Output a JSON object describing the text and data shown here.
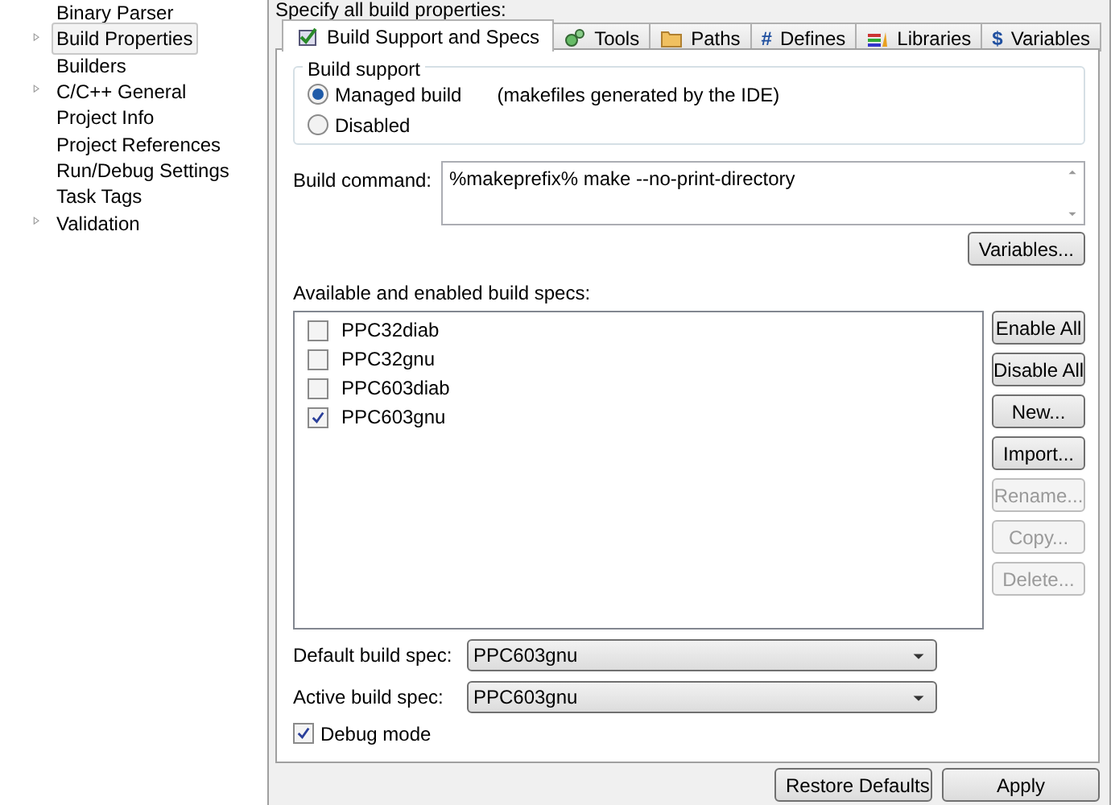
{
  "sidebar": {
    "items": [
      {
        "label": "Binary Parser",
        "expandable": false,
        "selected": false
      },
      {
        "label": "Build Properties",
        "expandable": true,
        "selected": true
      },
      {
        "label": "Builders",
        "expandable": false,
        "selected": false
      },
      {
        "label": "C/C++ General",
        "expandable": true,
        "selected": false
      },
      {
        "label": "Project Info",
        "expandable": false,
        "selected": false
      },
      {
        "label": "Project References",
        "expandable": false,
        "selected": false
      },
      {
        "label": "Run/Debug Settings",
        "expandable": false,
        "selected": false
      },
      {
        "label": "Task Tags",
        "expandable": false,
        "selected": false
      },
      {
        "label": "Validation",
        "expandable": true,
        "selected": false
      }
    ]
  },
  "header": "Specify all build properties:",
  "tabs": [
    {
      "label": "Build Support and Specs",
      "selected": true
    },
    {
      "label": "Tools",
      "selected": false
    },
    {
      "label": "Paths",
      "selected": false
    },
    {
      "glyph": "#",
      "label": "Defines",
      "selected": false
    },
    {
      "label": "Libraries",
      "selected": false
    },
    {
      "glyph": "$",
      "label": "Variables",
      "selected": false
    }
  ],
  "build_support": {
    "title": "Build support",
    "options": [
      {
        "label": "Managed build",
        "note": "(makefiles generated by the IDE)",
        "selected": true
      },
      {
        "label": "Disabled",
        "selected": false
      }
    ]
  },
  "build_command": {
    "label": "Build command:",
    "value": "%makeprefix% make --no-print-directory",
    "button": "Variables..."
  },
  "specs": {
    "label": "Available and enabled build specs:",
    "items": [
      {
        "label": "PPC32diab",
        "checked": false
      },
      {
        "label": "PPC32gnu",
        "checked": false
      },
      {
        "label": "PPC603diab",
        "checked": false
      },
      {
        "label": "PPC603gnu",
        "checked": true
      }
    ],
    "buttons": [
      {
        "label": "Enable All",
        "disabled": false
      },
      {
        "label": "Disable All",
        "disabled": false
      },
      {
        "label": "New...",
        "disabled": false
      },
      {
        "label": "Import...",
        "disabled": false
      },
      {
        "label": "Rename...",
        "disabled": true
      },
      {
        "label": "Copy...",
        "disabled": true
      },
      {
        "label": "Delete...",
        "disabled": true
      }
    ]
  },
  "default_spec": {
    "label": "Default build spec:",
    "value": "PPC603gnu"
  },
  "active_spec": {
    "label": "Active build spec:",
    "value": "PPC603gnu"
  },
  "debug_mode": {
    "label": "Debug mode",
    "checked": true
  },
  "footer_buttons": [
    "Restore Defaults",
    "Apply"
  ]
}
